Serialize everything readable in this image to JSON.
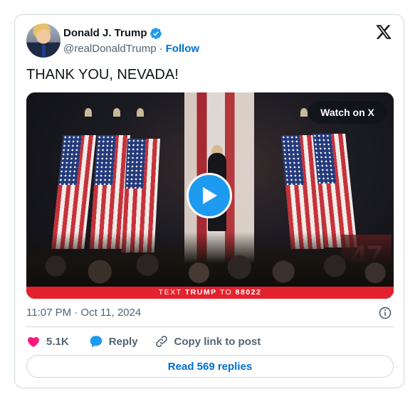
{
  "author": {
    "name": "Donald J. Trump",
    "handle": "@realDonaldTrump",
    "separator": "·",
    "follow_label": "Follow",
    "verified_color": "#1d9bf0"
  },
  "tweet": {
    "text": "THANK YOU, NEVADA!"
  },
  "media": {
    "watch_label": "Watch on X",
    "banner_prefix": "TEXT",
    "banner_keyword": "TRUMP",
    "banner_middle": "TO",
    "banner_number": "88022",
    "sign_text": "47",
    "play_color": "#1d9bf0",
    "banner_color": "#e4222d"
  },
  "meta": {
    "timestamp": "11:07 PM · Oct 11, 2024"
  },
  "actions": {
    "like_count": "5.1K",
    "reply_label": "Reply",
    "copy_label": "Copy link to post"
  },
  "footer": {
    "read_replies_label": "Read 569 replies"
  },
  "icons": [
    "verified-badge-icon",
    "x-logo-icon",
    "play-icon",
    "info-icon",
    "heart-icon",
    "reply-bubble-icon",
    "link-icon"
  ],
  "colors": {
    "link": "#006fd6",
    "secondary_text": "#536471",
    "border": "#cfd9de",
    "heart": "#f91880"
  }
}
